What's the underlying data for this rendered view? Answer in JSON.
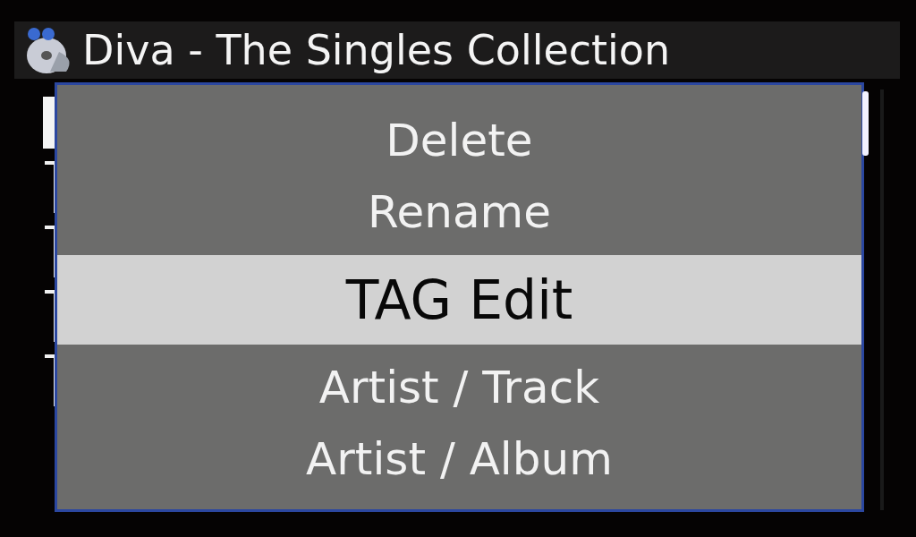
{
  "title": "Diva - The Singles Collection",
  "list": {
    "rows": [
      {
        "selected": true
      },
      {
        "selected": false
      },
      {
        "selected": false
      },
      {
        "selected": false
      },
      {
        "selected": false
      }
    ]
  },
  "menu": {
    "items": [
      {
        "label": "Delete",
        "selected": false
      },
      {
        "label": "Rename",
        "selected": false
      },
      {
        "label": "TAG Edit",
        "selected": true
      },
      {
        "label": "Artist / Track",
        "selected": false
      },
      {
        "label": "Artist / Album",
        "selected": false
      }
    ]
  }
}
